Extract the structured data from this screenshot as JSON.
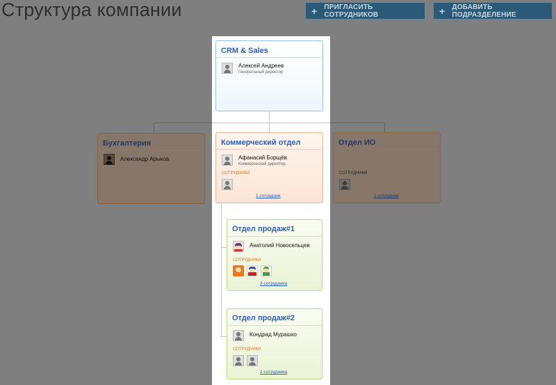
{
  "page": {
    "title": "Структура компании"
  },
  "actions": {
    "invite_label": "ПРИГЛАСИТЬ СОТРУДНИКОВ",
    "add_department_label": "ДОБАВИТЬ ПОДРАЗДЕЛЕНИЕ"
  },
  "colors": {
    "accent_button": "#2a5a78",
    "blue_title": "#2b5fb0",
    "orange_label": "#d07a2a"
  },
  "departments": {
    "root": {
      "name": "CRM & Sales",
      "head_name": "Алексей Андреев",
      "head_role": "Генеральный директор"
    },
    "accounting": {
      "name": "Бухгалтерия",
      "head_name": "Александр Арыков"
    },
    "commercial": {
      "name": "Коммерческий отдел",
      "head_name": "Афанасий Борщёв",
      "head_role": "Коммерческий директор",
      "staff_label": "СОТРУДНИКИ",
      "staff_link": "1 сотрудник"
    },
    "io": {
      "name": "Отдел ИО",
      "staff_label": "СОТРУДНИКИ",
      "staff_link": "1 сотрудник"
    },
    "sales1": {
      "name": "Отдел продаж#1",
      "head_name": "Анатолий Новосельцев",
      "staff_label": "СОТРУДНИКИ",
      "staff_link": "3 сотрудника"
    },
    "sales2": {
      "name": "Отдел продаж#2",
      "head_name": "Кондрад Мурашко",
      "staff_label": "СОТРУДНИКИ",
      "staff_link": "2 сотрудника"
    }
  }
}
